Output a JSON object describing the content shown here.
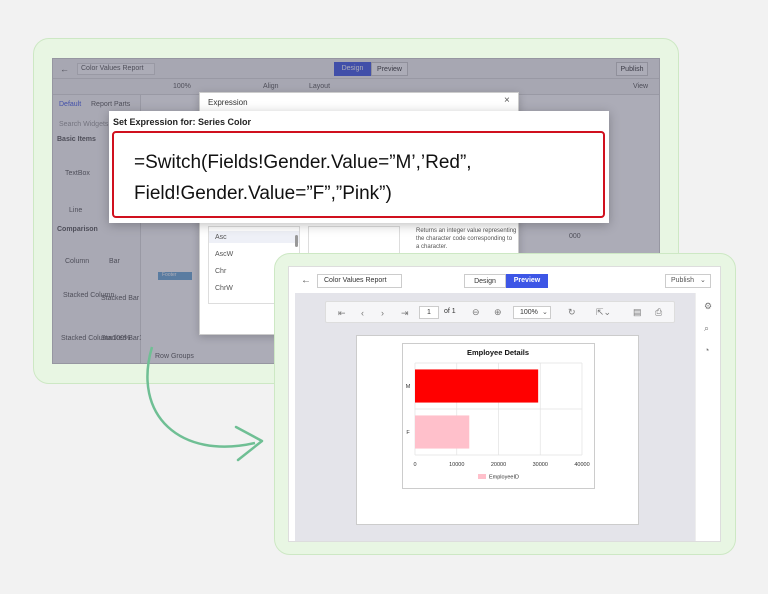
{
  "back": {
    "report_name": "Color Values Report",
    "design_tab": "Design",
    "preview_tab": "Preview",
    "publish": "Publish",
    "view": "View",
    "zoom": "100%",
    "align": "Align",
    "layout": "Layout",
    "panel_tabs": [
      "Default",
      "Report Parts"
    ],
    "search_placeholder": "Search Widgets",
    "basic_items": "Basic Items",
    "widgets": [
      "TextBox",
      "Line",
      "Column",
      "Bar",
      "Stacked Column",
      "Stacked Bar",
      "Stacked Column100%",
      "Stacked Bar100%"
    ],
    "comparison": "Comparison",
    "row_groups": "Row Groups",
    "footer_label": "Footer",
    "props_value": "000"
  },
  "expression_dialog": {
    "title": "Expression",
    "close": "×",
    "set_label": "Set Expression for: Series Color",
    "expression_line1": "=Switch(Fields!Gender.Value=”M’,’Red”,",
    "expression_line2": "Field!Gender.Value=”F”,”Pink”)",
    "functions": [
      "Asc",
      "AscW",
      "Chr",
      "ChrW"
    ],
    "description": [
      "Returns an integer value representing",
      "the character code corresponding to",
      "a character."
    ]
  },
  "front": {
    "report_name": "Color Values Report",
    "design_tab": "Design",
    "preview_tab": "Preview",
    "publish": "Publish",
    "page_number": "1",
    "of_pages": "of 1",
    "zoom": "100%",
    "colors": {
      "accent": "#3d56e6",
      "red": "#ff0000",
      "pink": "#ffc0cb"
    }
  },
  "chart_data": {
    "type": "bar",
    "title": "Employee Details",
    "categories": [
      "M",
      "F"
    ],
    "series": [
      {
        "name": "EmployeeID",
        "values": [
          29500,
          13000
        ],
        "colors": [
          "#ff0000",
          "#ffc0cb"
        ]
      }
    ],
    "xlim": [
      0,
      40000
    ],
    "ticks": [
      "0",
      "10000",
      "20000",
      "30000",
      "40000"
    ],
    "grid": true,
    "legend": "bottom"
  }
}
